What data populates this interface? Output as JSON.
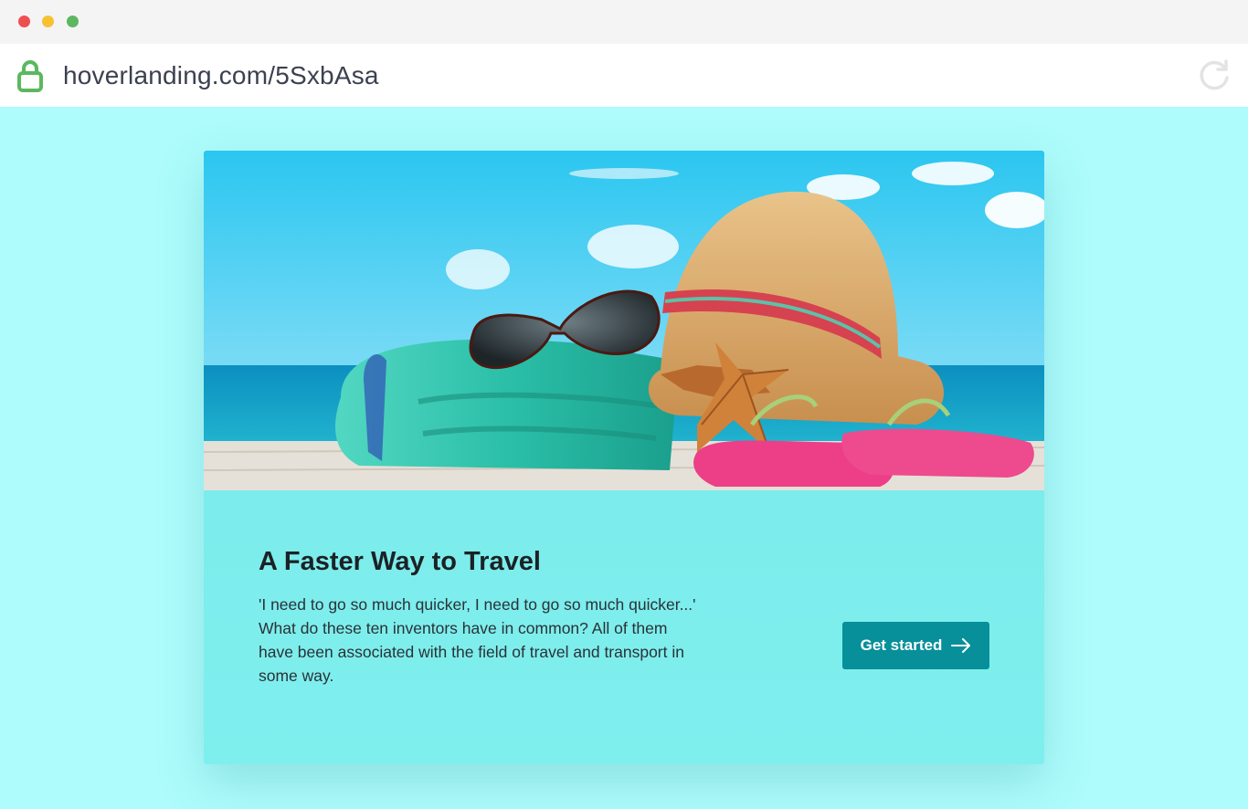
{
  "browser": {
    "url": "hoverlanding.com/5SxbAsa",
    "icons": {
      "lock": "lock-icon",
      "reload": "reload-icon"
    },
    "traffic_lights": [
      "close",
      "minimize",
      "maximize"
    ]
  },
  "card": {
    "image": "beach-accessories-photo",
    "title": "A Faster Way to Travel",
    "description": "'I need to go so much quicker, I need to go so much quicker...' What do these ten inventors have in common? All of them have been associated with the field of travel and transport in some way.",
    "cta_label": "Get started",
    "cta_icon": "arrow-right-icon"
  },
  "colors": {
    "page_background": "#aefcfc",
    "card_background": "#7eeeed",
    "button_background": "#078f9a",
    "lock_green": "#5cb85f"
  }
}
